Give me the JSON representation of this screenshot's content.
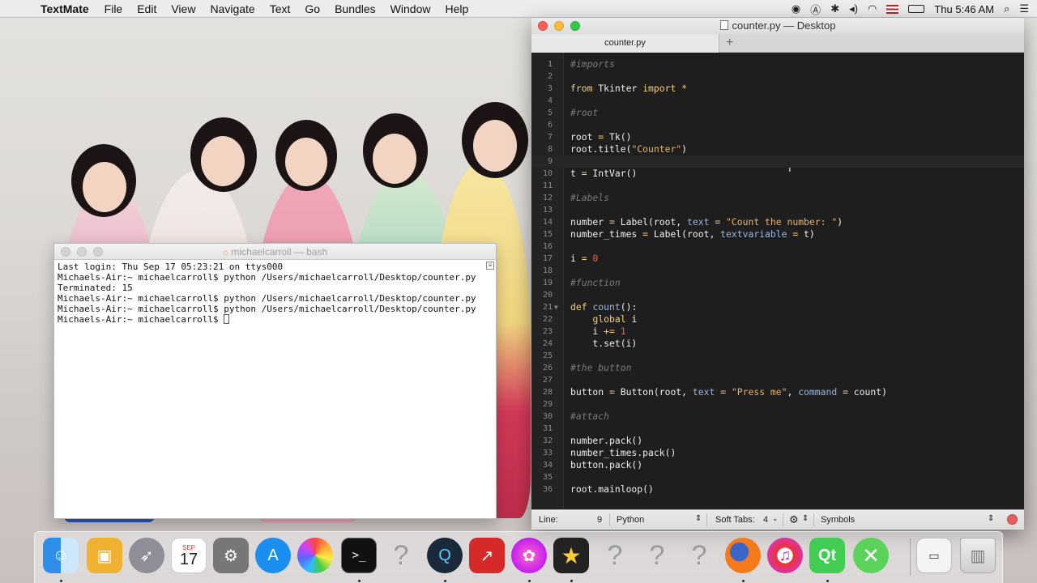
{
  "menubar": {
    "apple_icon": "apple-icon",
    "app_name": "TextMate",
    "menus": [
      "File",
      "Edit",
      "View",
      "Navigate",
      "Text",
      "Go",
      "Bundles",
      "Window",
      "Help"
    ],
    "clock": "Thu 5:46 AM"
  },
  "terminal": {
    "title": "michaelcarroll — bash",
    "lines": [
      "Last login: Thu Sep 17 05:23:21 on ttys000",
      "Michaels-Air:~ michaelcarroll$ python /Users/michaelcarroll/Desktop/counter.py",
      "Terminated: 15",
      "Michaels-Air:~ michaelcarroll$ python /Users/michaelcarroll/Desktop/counter.py",
      "Michaels-Air:~ michaelcarroll$ python /Users/michaelcarroll/Desktop/counter.py",
      "Michaels-Air:~ michaelcarroll$ "
    ]
  },
  "editor": {
    "title": "counter.py — Desktop",
    "tab_label": "counter.py",
    "tab_add": "+",
    "current_line": 9,
    "lines": [
      "#imports",
      "",
      "from Tkinter import *",
      "",
      "#root",
      "",
      "root = Tk()",
      "root.title(\"Counter\")",
      "",
      "t = IntVar()",
      "",
      "#Labels",
      "",
      "number = Label(root, text = \"Count the number: \")",
      "number_times = Label(root, textvariable = t)",
      "",
      "i = 0",
      "",
      "#function",
      "",
      "def count():",
      "    global i",
      "    i += 1",
      "    t.set(i)",
      "",
      "#the button",
      "",
      "button = Button(root, text = \"Press me\", command = count)",
      "",
      "#attach",
      "",
      "number.pack()",
      "number_times.pack()",
      "button.pack()",
      "",
      "root.mainloop()"
    ],
    "status": {
      "line_label": "Line:",
      "line_value": "9",
      "language": "Python",
      "tabs": "Soft Tabs:",
      "tab_size": "4",
      "symbols": "Symbols"
    }
  },
  "dock": {
    "calendar_month": "SEP",
    "calendar_day": "17",
    "items": [
      "finder",
      "photo-slideshow",
      "launchpad",
      "calendar",
      "system-preferences",
      "app-store",
      "photos",
      "terminal",
      "unknown-app-1",
      "quicktime",
      "app-red",
      "flower-app",
      "imovie",
      "unknown-app-2",
      "unknown-app-3",
      "unknown-app-4",
      "firefox",
      "itunes",
      "qt-creator",
      "xquartz",
      "preview-screenshot",
      "trash"
    ]
  }
}
